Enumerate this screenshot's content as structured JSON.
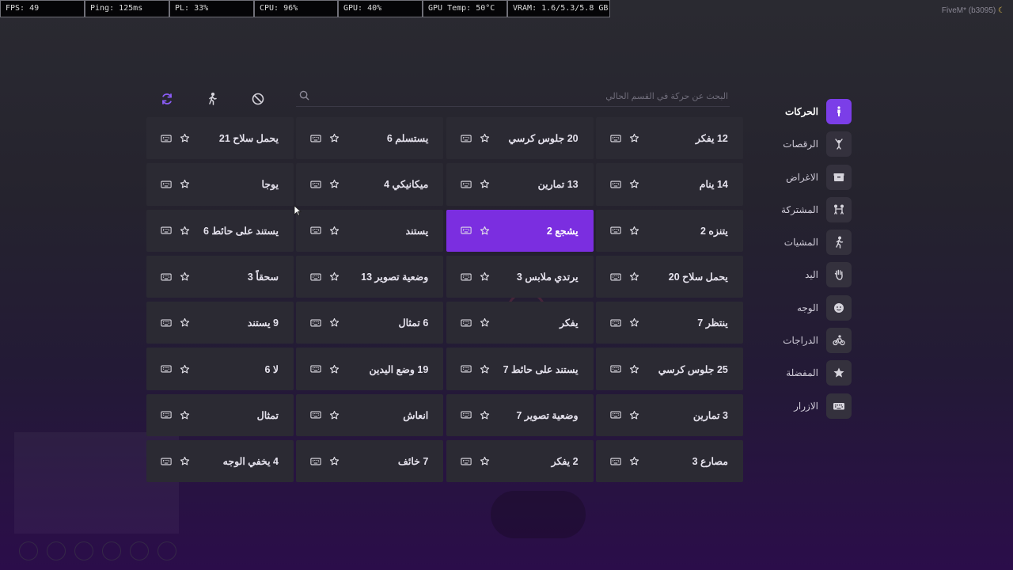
{
  "debug_bar": [
    {
      "label": "FPS: 49"
    },
    {
      "label": "Ping: 125ms"
    },
    {
      "label": "PL: 33%"
    },
    {
      "label": "CPU: 96%"
    },
    {
      "label": "GPU: 40%"
    },
    {
      "label": "GPU Temp: 50°C"
    },
    {
      "label": "VRAM: 1.6/5.3/5.8 GB"
    }
  ],
  "app_title": "FiveM* (b3095)",
  "search": {
    "placeholder": "البحث عن حركة في القسم الحالي"
  },
  "toolbar": [
    {
      "name": "refresh-icon",
      "color": "#8b5cf6"
    },
    {
      "name": "walk-icon",
      "color": "#d6d4dc"
    },
    {
      "name": "cancel-icon",
      "color": "#d6d4dc"
    }
  ],
  "sidebar": {
    "items": [
      {
        "label": "الحركات",
        "icon": "person-icon",
        "active": true
      },
      {
        "label": "الرقصات",
        "icon": "dance-icon",
        "active": false
      },
      {
        "label": "الاغراض",
        "icon": "box-icon",
        "active": false
      },
      {
        "label": "المشتركة",
        "icon": "shared-icon",
        "active": false
      },
      {
        "label": "المشيات",
        "icon": "walk-icon",
        "active": false
      },
      {
        "label": "اليد",
        "icon": "hand-icon",
        "active": false
      },
      {
        "label": "الوجه",
        "icon": "face-icon",
        "active": false
      },
      {
        "label": "الدراجات",
        "icon": "bike-icon",
        "active": false
      },
      {
        "label": "المفضلة",
        "icon": "star-icon",
        "active": false
      },
      {
        "label": "الازرار",
        "icon": "keyboard-icon",
        "active": false
      }
    ]
  },
  "emotes": [
    {
      "label": "يحمل سلاح 21"
    },
    {
      "label": "يستسلم 6"
    },
    {
      "label": "20 جلوس كرسي"
    },
    {
      "label": "12 يفكر"
    },
    {
      "label": "يوجا"
    },
    {
      "label": "ميكانيكي 4"
    },
    {
      "label": "13 تمارين"
    },
    {
      "label": "14 ينام"
    },
    {
      "label": "يستند على حائط 6"
    },
    {
      "label": "يستند"
    },
    {
      "label": "يشجع 2",
      "selected": true
    },
    {
      "label": "يتنزه 2"
    },
    {
      "label": "سحقاً 3"
    },
    {
      "label": "وضعية تصوير 13"
    },
    {
      "label": "يرتدي ملابس 3"
    },
    {
      "label": "يحمل سلاح 20"
    },
    {
      "label": "9 يستند"
    },
    {
      "label": "6 تمثال"
    },
    {
      "label": "يفكر"
    },
    {
      "label": "ينتظر 7"
    },
    {
      "label": "لا 6"
    },
    {
      "label": "19 وضع اليدين"
    },
    {
      "label": "يستند على حائط 7"
    },
    {
      "label": "25 جلوس كرسي"
    },
    {
      "label": "تمثال"
    },
    {
      "label": "انعاش"
    },
    {
      "label": "وضعية تصوير 7"
    },
    {
      "label": "3 تمارين"
    },
    {
      "label": "4 يخفي الوجه"
    },
    {
      "label": "7 خائف"
    },
    {
      "label": "2 يفكر"
    },
    {
      "label": "مصارع 3"
    }
  ],
  "colors": {
    "accent": "#7b2ee0",
    "cell": "#2b2a33",
    "icon_bg": "#34313d"
  }
}
